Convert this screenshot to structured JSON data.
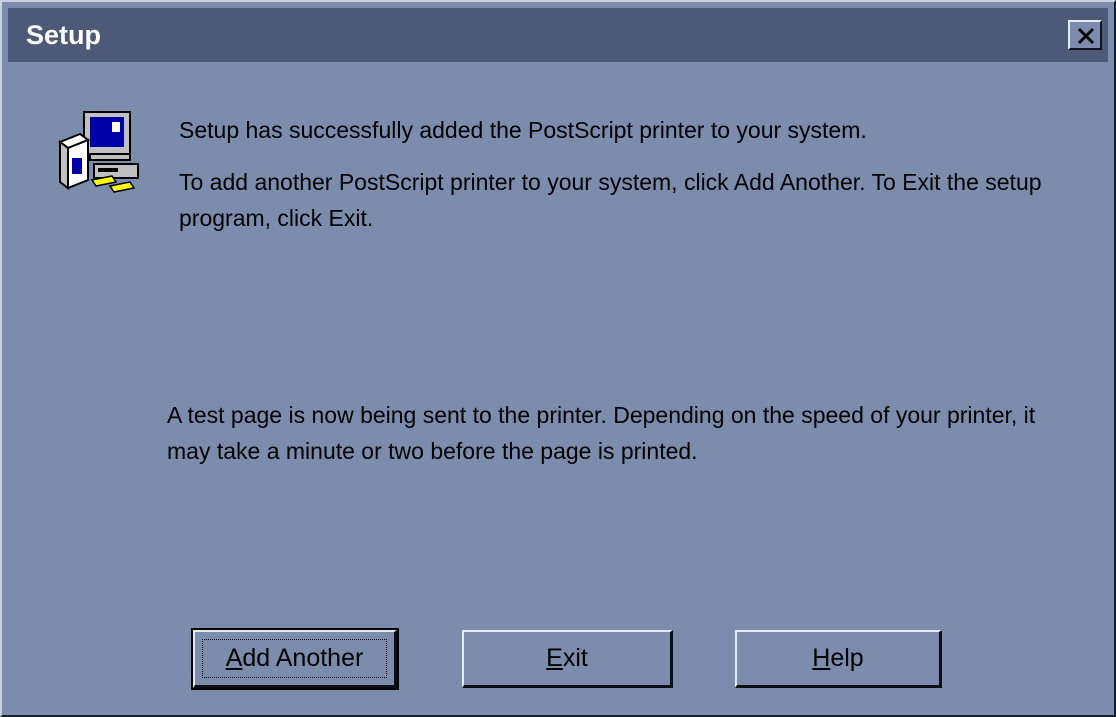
{
  "window": {
    "title": "Setup",
    "close_icon": "close-icon"
  },
  "icon": "setup-computer-icon",
  "messages": {
    "line1": "Setup has successfully added the PostScript printer to your system.",
    "line2": "To add another PostScript printer to your system, click Add Another.  To Exit the setup program, click Exit.",
    "line3": "A test page is now being sent to the printer.  Depending on the speed of your printer, it may take a minute or two before the page is printed."
  },
  "buttons": {
    "add_another": {
      "label": "Add Another",
      "mnemonic": "A",
      "rest": "dd Another"
    },
    "exit": {
      "label": "Exit",
      "mnemonic": "E",
      "rest": "xit"
    },
    "help": {
      "label": "Help",
      "mnemonic": "H",
      "rest": "elp"
    }
  },
  "colors": {
    "background": "#7b8cac",
    "titlebar": "#4c5a78",
    "title_text": "#ffffff"
  }
}
